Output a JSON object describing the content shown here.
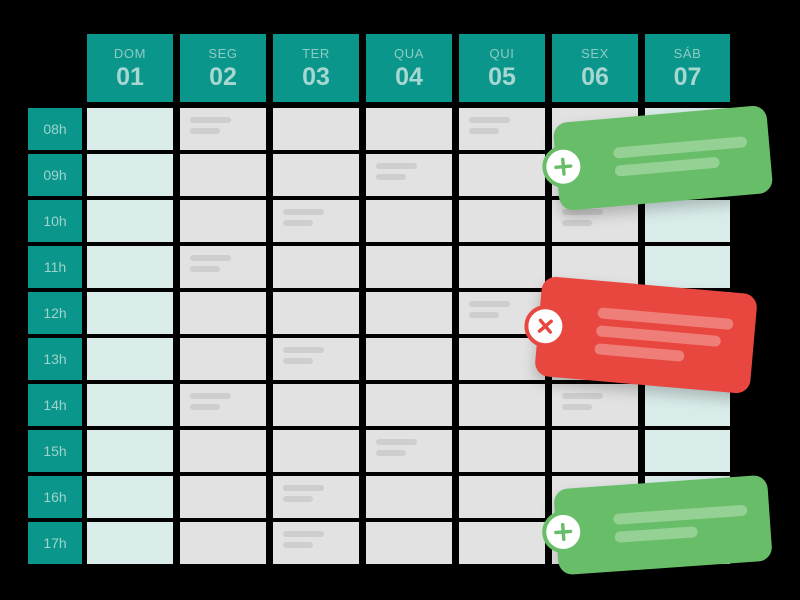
{
  "theme": {
    "page_background": "#000000",
    "accent_teal": "#0a968a",
    "slot_gray": "#e2e2e2",
    "weekend_cyan": "#d9ecea",
    "placeholder_gray": "#cecece",
    "card_green": "#68bd68",
    "card_red": "#e8473f"
  },
  "calendar": {
    "days": [
      {
        "dow": "DOM",
        "num": "01",
        "weekend": true
      },
      {
        "dow": "SEG",
        "num": "02",
        "weekend": false
      },
      {
        "dow": "TER",
        "num": "03",
        "weekend": false
      },
      {
        "dow": "QUA",
        "num": "04",
        "weekend": false
      },
      {
        "dow": "QUI",
        "num": "05",
        "weekend": false
      },
      {
        "dow": "SEX",
        "num": "06",
        "weekend": false
      },
      {
        "dow": "SÁB",
        "num": "07",
        "weekend": true
      }
    ],
    "hours": [
      "08h",
      "09h",
      "10h",
      "11h",
      "12h",
      "13h",
      "14h",
      "15h",
      "16h",
      "17h"
    ],
    "filled_slots": [
      {
        "hour": "08h",
        "day": "SEG"
      },
      {
        "hour": "08h",
        "day": "QUI"
      },
      {
        "hour": "09h",
        "day": "QUA"
      },
      {
        "hour": "10h",
        "day": "TER"
      },
      {
        "hour": "10h",
        "day": "SEX"
      },
      {
        "hour": "11h",
        "day": "SEG"
      },
      {
        "hour": "12h",
        "day": "QUI"
      },
      {
        "hour": "13h",
        "day": "TER"
      },
      {
        "hour": "14h",
        "day": "SEG"
      },
      {
        "hour": "14h",
        "day": "SEX"
      },
      {
        "hour": "15h",
        "day": "QUA"
      },
      {
        "hour": "16h",
        "day": "TER"
      },
      {
        "hour": "17h",
        "day": "TER"
      }
    ],
    "event_cards": [
      {
        "id": "card-add-top",
        "type": "add",
        "icon": "plus-icon",
        "color": "#68bd68",
        "bar_count": 2
      },
      {
        "id": "card-cancel",
        "type": "cancel",
        "icon": "close-icon",
        "color": "#e8473f",
        "bar_count": 3
      },
      {
        "id": "card-add-bottom",
        "type": "add",
        "icon": "plus-icon",
        "color": "#68bd68",
        "bar_count": 2
      }
    ]
  }
}
